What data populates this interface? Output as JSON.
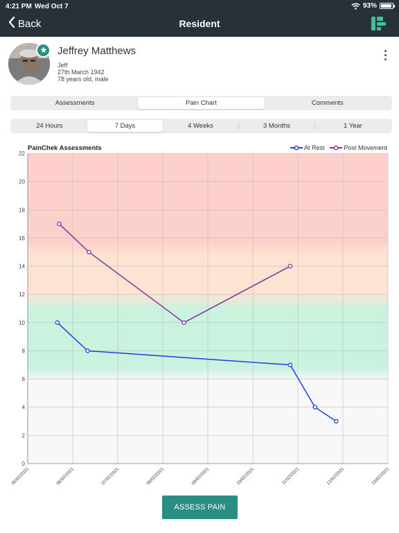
{
  "status_bar": {
    "time": "4:21 PM",
    "date": "Wed Oct 7",
    "battery": "93%"
  },
  "nav": {
    "back_label": "Back",
    "title": "Resident"
  },
  "profile": {
    "name": "Jeffrey Matthews",
    "nickname": "Jeff",
    "dob": "27th March 1942",
    "age_gender": "78 years old, male"
  },
  "tabs": [
    {
      "label": "Assessments",
      "active": false
    },
    {
      "label": "Pain Chart",
      "active": true
    },
    {
      "label": "Comments",
      "active": false
    }
  ],
  "ranges": [
    {
      "label": "24 Hours",
      "active": false
    },
    {
      "label": "7 Days",
      "active": true
    },
    {
      "label": "4 Weeks",
      "active": false
    },
    {
      "label": "3 Months",
      "active": false
    },
    {
      "label": "1 Year",
      "active": false
    }
  ],
  "chart_data": {
    "type": "line",
    "title": "PainChek Assessments",
    "legend_position": "top-right",
    "grid": true,
    "ylim": [
      0,
      22
    ],
    "y_ticks": [
      0,
      2,
      4,
      6,
      8,
      10,
      12,
      14,
      16,
      18,
      20,
      22
    ],
    "x_ticks": [
      "05/02/2021",
      "06/02/2021",
      "07/02/2021",
      "08/02/2021",
      "09/02/2021",
      "10/02/2021",
      "11/02/2021",
      "12/02/2021",
      "13/02/2021"
    ],
    "zones": [
      {
        "from": 0,
        "to": 6,
        "color": "#f8f8f9"
      },
      {
        "from": 6,
        "to": 11.5,
        "color": "#c9f2df"
      },
      {
        "from": 11.5,
        "to": 15,
        "color": "#fde4d2"
      },
      {
        "from": 15,
        "to": 22,
        "color": "#fdd0cb"
      }
    ],
    "series": [
      {
        "name": "At Rest",
        "color": "#1f3de0",
        "points": [
          {
            "x": 0.66,
            "y": 10
          },
          {
            "x": 1.33,
            "y": 8
          },
          {
            "x": 5.83,
            "y": 7
          },
          {
            "x": 6.38,
            "y": 4
          },
          {
            "x": 6.85,
            "y": 3
          }
        ]
      },
      {
        "name": "Post Movement",
        "color": "#8b2c9a",
        "points": [
          {
            "x": 0.7,
            "y": 17
          },
          {
            "x": 1.36,
            "y": 15
          },
          {
            "x": 3.47,
            "y": 10
          },
          {
            "x": 5.83,
            "y": 14
          }
        ]
      }
    ]
  },
  "actions": {
    "assess_label": "ASSESS PAIN"
  },
  "theme": {
    "header": "#283138",
    "accent": "#2a8e83"
  },
  "icons": [
    "chevron-left-icon",
    "wifi-icon",
    "battery-icon",
    "painchek-logo-icon",
    "star-icon",
    "more-vertical-icon"
  ]
}
